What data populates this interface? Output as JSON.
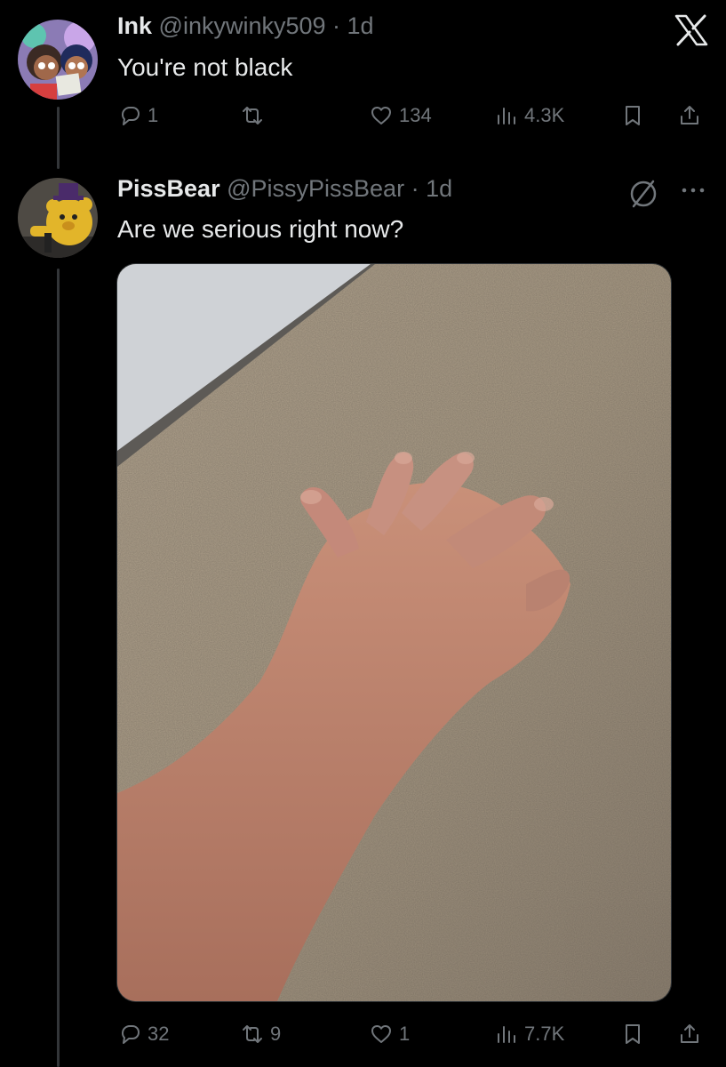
{
  "tweets": [
    {
      "name": "Ink",
      "handle": "@inkywinky509",
      "time": "· 1d",
      "text": "You're not black",
      "stats": {
        "replies": "1",
        "retweets": "",
        "likes": "134",
        "views": "4.3K"
      }
    },
    {
      "name": "PissBear",
      "handle": "@PissyPissBear",
      "time": "· 1d",
      "text": "Are we serious right now?",
      "stats": {
        "replies": "32",
        "retweets": "9",
        "likes": "1",
        "views": "7.7K"
      }
    }
  ],
  "icons": {
    "platform": "x-logo-icon",
    "reply": "reply-icon",
    "retweet": "retweet-icon",
    "like": "heart-icon",
    "views": "views-icon",
    "bookmark": "bookmark-icon",
    "share": "share-icon",
    "more": "more-icon",
    "spam": "no-entry-icon"
  },
  "colors": {
    "background": "#000000",
    "text": "#e7e9ea",
    "muted": "#71767b"
  }
}
